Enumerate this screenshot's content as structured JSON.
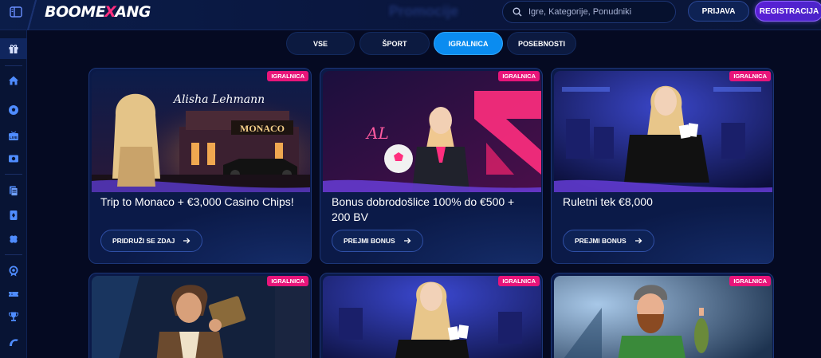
{
  "header": {
    "logo_left": "BOOME",
    "logo_mark": "X",
    "logo_right": "ANG",
    "page_title": "Promocije",
    "search_placeholder": "Igre, Kategorije, Ponudniki",
    "login_label": "PRIJAVA",
    "register_label": "REGISTRACIJA"
  },
  "sidebar": {
    "items": [
      {
        "icon": "gift-icon"
      },
      {
        "icon": "home-icon"
      },
      {
        "icon": "soccer-ball-icon"
      },
      {
        "icon": "live-icon"
      },
      {
        "icon": "virtual-sports-icon"
      },
      {
        "icon": "betslip-icon"
      },
      {
        "icon": "casino-card-icon"
      },
      {
        "icon": "clover-icon"
      },
      {
        "icon": "badge-icon"
      },
      {
        "icon": "ticket-icon"
      },
      {
        "icon": "trophy-icon"
      },
      {
        "icon": "boomerang-icon"
      }
    ]
  },
  "tabs": [
    {
      "label": "VSE",
      "active": false
    },
    {
      "label": "ŠPORT",
      "active": false
    },
    {
      "label": "IGRALNICA",
      "active": true
    },
    {
      "label": "POSEBNOSTI",
      "active": false
    }
  ],
  "cards": [
    {
      "badge": "IGRALNICA",
      "title": "Trip to Monaco + €3,000 Casino Chips!",
      "button": "PRIDRUŽI SE ZDAJ",
      "image": "monaco-promo-image",
      "signature": "Alisha Lehmann",
      "sign": "MONACO"
    },
    {
      "badge": "IGRALNICA",
      "title": "Bonus dobrodošlice 100% do €500 + 200 BV",
      "button": "PREJMI BONUS",
      "image": "welcome-bonus-image",
      "signature": "AL"
    },
    {
      "badge": "IGRALNICA",
      "title": "Ruletni tek €8,000",
      "button": "PREJMI BONUS",
      "image": "roulette-race-image"
    },
    {
      "badge": "IGRALNICA",
      "image": "adventurer-promo-image"
    },
    {
      "badge": "IGRALNICA",
      "image": "live-casino-dealer-image"
    },
    {
      "badge": "IGRALNICA",
      "image": "fisherman-promo-image"
    }
  ],
  "colors": {
    "background": "#050a22",
    "accent_blue": "#0a8cf0",
    "badge_pink": "#e8157a",
    "register_purple": "#5a1fd6"
  }
}
